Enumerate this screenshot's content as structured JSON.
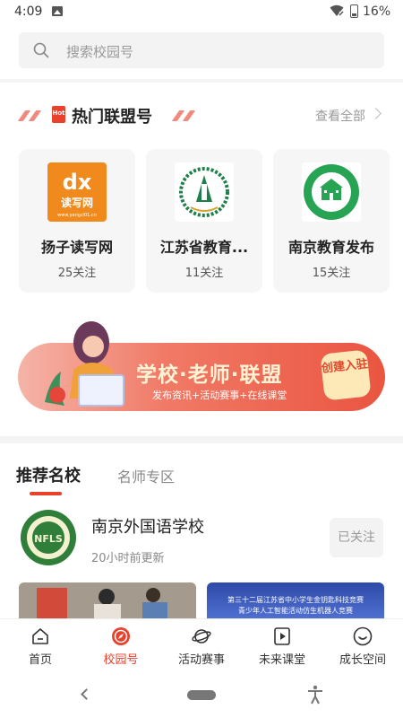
{
  "status_bar": {
    "time": "4:09",
    "battery_percent": "16%",
    "icons": [
      "image-notification-icon",
      "wifi-off-icon",
      "battery-icon"
    ]
  },
  "search": {
    "placeholder": "搜索校园号",
    "icon": "search-icon"
  },
  "hot_section": {
    "title": "热门联盟号",
    "badge": "Hot",
    "see_all": "查看全部",
    "accent_color": "#e8412c",
    "cards": [
      {
        "name": "扬子读写网",
        "followers": "25关注",
        "logo_text": "dx",
        "logo_sub": "读写网",
        "logo_url_text": "www.yangzi01.cn",
        "logo_color": "#f08a1c"
      },
      {
        "name": "江苏省教育...",
        "followers": "11关注",
        "logo_color": "#1e7f4a"
      },
      {
        "name": "南京教育发布",
        "followers": "15关注",
        "logo_color": "#27a354"
      }
    ]
  },
  "banner": {
    "title": "学校·老师·联盟",
    "subtitle": "发布资讯+活动赛事+在线课堂",
    "cta": "创建入驻"
  },
  "tabs": {
    "recommended": "推荐名校",
    "teachers": "名师专区"
  },
  "school": {
    "name": "南京外国语学校",
    "updated": "20小时前更新",
    "follow_state": "已关注",
    "logo_text": "NFLS"
  },
  "photos": {
    "right_caption_1": "第三十二届江苏省中小学生金钥匙科技竞赛",
    "right_caption_2": "青少年人工智能活动仿生机器人竞赛"
  },
  "bottom_nav": {
    "items": [
      {
        "label": "首页",
        "icon": "home-icon"
      },
      {
        "label": "校园号",
        "icon": "compass-icon",
        "active": true
      },
      {
        "label": "活动赛事",
        "icon": "planet-icon"
      },
      {
        "label": "未来课堂",
        "icon": "play-icon"
      },
      {
        "label": "成长空间",
        "icon": "smile-icon"
      }
    ]
  }
}
